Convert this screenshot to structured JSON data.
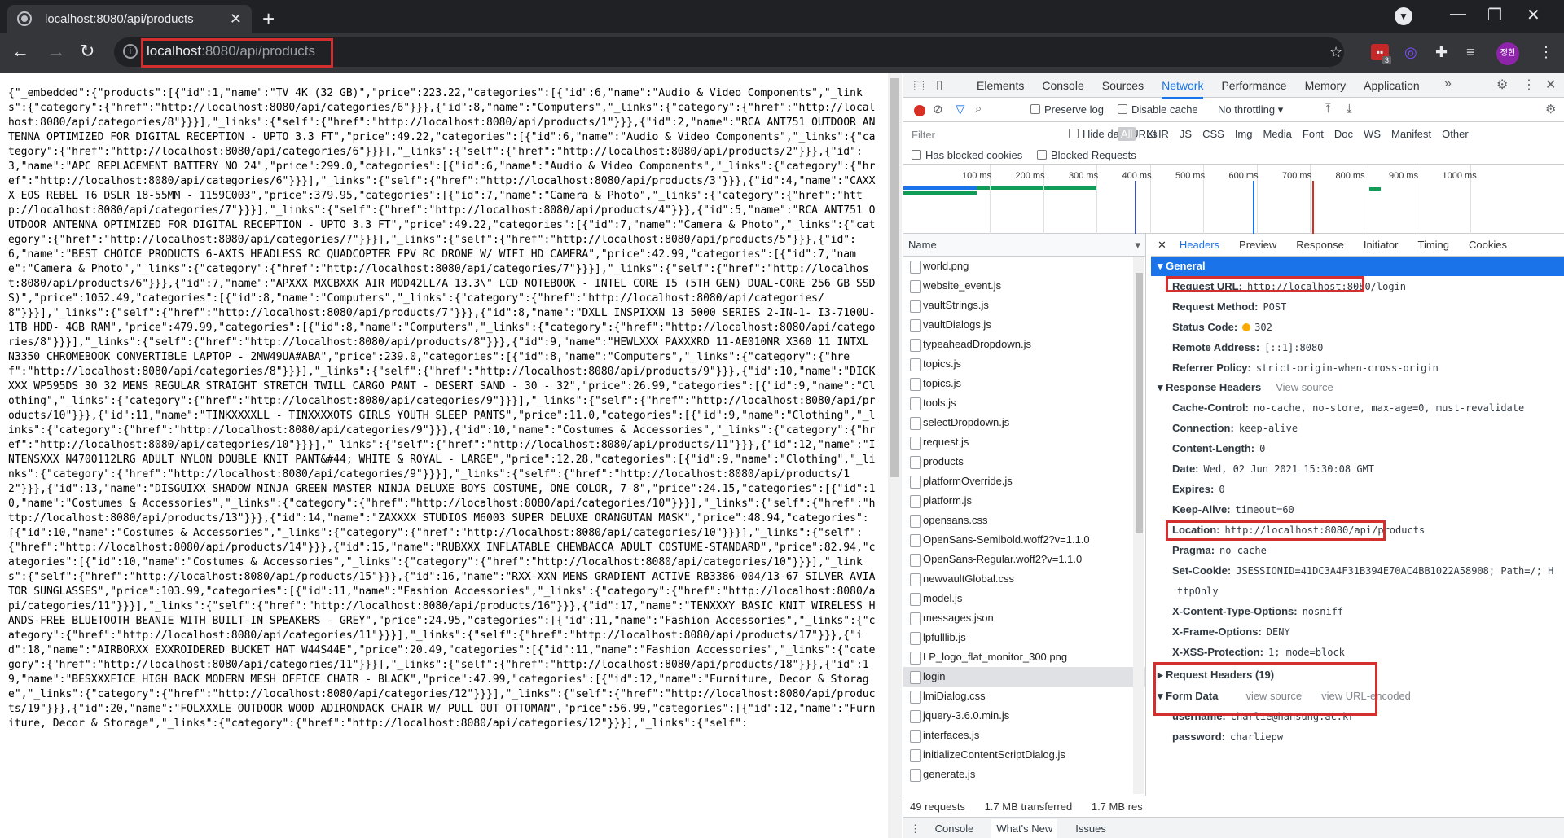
{
  "browser": {
    "tab_title": "localhost:8080/api/products",
    "url_host": "localhost",
    "url_rest": ":8080/api/products",
    "ext_badge": "3",
    "avatar_text": "정현"
  },
  "json_text": "{\"_embedded\":{\"products\":[{\"id\":1,\"name\":\"TV 4K (32 GB)\",\"price\":223.22,\"categories\":[{\"id\":6,\"name\":\"Audio & Video Components\",\"_links\":{\"category\":{\"href\":\"http://localhost:8080/api/categories/6\"}}},{\"id\":8,\"name\":\"Computers\",\"_links\":{\"category\":{\"href\":\"http://localhost:8080/api/categories/8\"}}}],\"_links\":{\"self\":{\"href\":\"http://localhost:8080/api/products/1\"}}},{\"id\":2,\"name\":\"RCA ANT751 OUTDOOR ANTENNA OPTIMIZED FOR DIGITAL RECEPTION - UPTO 3.3 FT\",\"price\":49.22,\"categories\":[{\"id\":6,\"name\":\"Audio & Video Components\",\"_links\":{\"category\":{\"href\":\"http://localhost:8080/api/categories/6\"}}}],\"_links\":{\"self\":{\"href\":\"http://localhost:8080/api/products/2\"}}},{\"id\":3,\"name\":\"APC REPLACEMENT BATTERY NO 24\",\"price\":299.0,\"categories\":[{\"id\":6,\"name\":\"Audio & Video Components\",\"_links\":{\"category\":{\"href\":\"http://localhost:8080/api/categories/6\"}}}],\"_links\":{\"self\":{\"href\":\"http://localhost:8080/api/products/3\"}}},{\"id\":4,\"name\":\"CAXXX EOS REBEL T6 DSLR 18-55MM - 1159C003\",\"price\":379.95,\"categories\":[{\"id\":7,\"name\":\"Camera & Photo\",\"_links\":{\"category\":{\"href\":\"http://localhost:8080/api/categories/7\"}}}],\"_links\":{\"self\":{\"href\":\"http://localhost:8080/api/products/4\"}}},{\"id\":5,\"name\":\"RCA ANT751 OUTDOOR ANTENNA OPTIMIZED FOR DIGITAL RECEPTION - UPTO 3.3 FT\",\"price\":49.22,\"categories\":[{\"id\":7,\"name\":\"Camera & Photo\",\"_links\":{\"category\":{\"href\":\"http://localhost:8080/api/categories/7\"}}}],\"_links\":{\"self\":{\"href\":\"http://localhost:8080/api/products/5\"}}},{\"id\":6,\"name\":\"BEST CHOICE PRODUCTS 6-AXIS HEADLESS RC QUADCOPTER FPV RC DRONE W/ WIFI HD CAMERA\",\"price\":42.99,\"categories\":[{\"id\":7,\"name\":\"Camera & Photo\",\"_links\":{\"category\":{\"href\":\"http://localhost:8080/api/categories/7\"}}}],\"_links\":{\"self\":{\"href\":\"http://localhost:8080/api/products/6\"}}},{\"id\":7,\"name\":\"APXXX MXCBXXK AIR MOD42LL/A 13.3\\\" LCD NOTEBOOK - INTEL CORE I5 (5TH GEN) DUAL-CORE 256 GB SSD S)\",\"price\":1052.49,\"categories\":[{\"id\":8,\"name\":\"Computers\",\"_links\":{\"category\":{\"href\":\"http://localhost:8080/api/categories/8\"}}}],\"_links\":{\"self\":{\"href\":\"http://localhost:8080/api/products/7\"}}},{\"id\":8,\"name\":\"DXLL INSPIXXN 13 5000 SERIES 2-IN-1- I3-7100U- 1TB HDD- 4GB RAM\",\"price\":479.99,\"categories\":[{\"id\":8,\"name\":\"Computers\",\"_links\":{\"category\":{\"href\":\"http://localhost:8080/api/categories/8\"}}}],\"_links\":{\"self\":{\"href\":\"http://localhost:8080/api/products/8\"}}},{\"id\":9,\"name\":\"HEWLXXX PAXXXRD 11-AE010NR X360 11 INTXL N3350 CHROMEBOOK CONVERTIBLE LAPTOP - 2MW49UA#ABA\",\"price\":239.0,\"categories\":[{\"id\":8,\"name\":\"Computers\",\"_links\":{\"category\":{\"href\":\"http://localhost:8080/api/categories/8\"}}}],\"_links\":{\"self\":{\"href\":\"http://localhost:8080/api/products/9\"}}},{\"id\":10,\"name\":\"DICKXXX WP595DS 30 32 MENS REGULAR STRAIGHT STRETCH TWILL CARGO PANT - DESERT SAND - 30 - 32\",\"price\":26.99,\"categories\":[{\"id\":9,\"name\":\"Clothing\",\"_links\":{\"category\":{\"href\":\"http://localhost:8080/api/categories/9\"}}}],\"_links\":{\"self\":{\"href\":\"http://localhost:8080/api/products/10\"}}},{\"id\":11,\"name\":\"TINKXXXXLL - TINXXXXOTS GIRLS YOUTH SLEEP PANTS\",\"price\":11.0,\"categories\":[{\"id\":9,\"name\":\"Clothing\",\"_links\":{\"category\":{\"href\":\"http://localhost:8080/api/categories/9\"}}},{\"id\":10,\"name\":\"Costumes & Accessories\",\"_links\":{\"category\":{\"href\":\"http://localhost:8080/api/categories/10\"}}}],\"_links\":{\"self\":{\"href\":\"http://localhost:8080/api/products/11\"}}},{\"id\":12,\"name\":\"INTENSXXX N4700112LRG ADULT NYLON DOUBLE KNIT PANT&#44; WHITE & ROYAL - LARGE\",\"price\":12.28,\"categories\":[{\"id\":9,\"name\":\"Clothing\",\"_links\":{\"category\":{\"href\":\"http://localhost:8080/api/categories/9\"}}}],\"_links\":{\"self\":{\"href\":\"http://localhost:8080/api/products/12\"}}},{\"id\":13,\"name\":\"DISGUIXX SHADOW NINJA GREEN MASTER NINJA DELUXE BOYS COSTUME, ONE COLOR, 7-8\",\"price\":24.15,\"categories\":[{\"id\":10,\"name\":\"Costumes & Accessories\",\"_links\":{\"category\":{\"href\":\"http://localhost:8080/api/categories/10\"}}}],\"_links\":{\"self\":{\"href\":\"http://localhost:8080/api/products/13\"}}},{\"id\":14,\"name\":\"ZAXXXX STUDIOS M6003 SUPER DELUXE ORANGUTAN MASK\",\"price\":48.94,\"categories\":[{\"id\":10,\"name\":\"Costumes & Accessories\",\"_links\":{\"category\":{\"href\":\"http://localhost:8080/api/categories/10\"}}}],\"_links\":{\"self\":{\"href\":\"http://localhost:8080/api/products/14\"}}},{\"id\":15,\"name\":\"RUBXXX INFLATABLE CHEWBACCA ADULT COSTUME-STANDARD\",\"price\":82.94,\"categories\":[{\"id\":10,\"name\":\"Costumes & Accessories\",\"_links\":{\"category\":{\"href\":\"http://localhost:8080/api/categories/10\"}}}],\"_links\":{\"self\":{\"href\":\"http://localhost:8080/api/products/15\"}}},{\"id\":16,\"name\":\"RXX-XXN MENS GRADIENT ACTIVE RB3386-004/13-67 SILVER AVIATOR SUNGLASSES\",\"price\":103.99,\"categories\":[{\"id\":11,\"name\":\"Fashion Accessories\",\"_links\":{\"category\":{\"href\":\"http://localhost:8080/api/categories/11\"}}}],\"_links\":{\"self\":{\"href\":\"http://localhost:8080/api/products/16\"}}},{\"id\":17,\"name\":\"TENXXXY BASIC KNIT WIRELESS HANDS-FREE BLUETOOTH BEANIE WITH BUILT-IN SPEAKERS - GREY\",\"price\":24.95,\"categories\":[{\"id\":11,\"name\":\"Fashion Accessories\",\"_links\":{\"category\":{\"href\":\"http://localhost:8080/api/categories/11\"}}}],\"_links\":{\"self\":{\"href\":\"http://localhost:8080/api/products/17\"}}},{\"id\":18,\"name\":\"AIRBORXX EXXROIDERED BUCKET HAT W44S44E\",\"price\":20.49,\"categories\":[{\"id\":11,\"name\":\"Fashion Accessories\",\"_links\":{\"category\":{\"href\":\"http://localhost:8080/api/categories/11\"}}}],\"_links\":{\"self\":{\"href\":\"http://localhost:8080/api/products/18\"}}},{\"id\":19,\"name\":\"BESXXXFICE HIGH BACK MODERN MESH OFFICE CHAIR - BLACK\",\"price\":47.99,\"categories\":[{\"id\":12,\"name\":\"Furniture, Decor & Storage\",\"_links\":{\"category\":{\"href\":\"http://localhost:8080/api/categories/12\"}}}],\"_links\":{\"self\":{\"href\":\"http://localhost:8080/api/products/19\"}}},{\"id\":20,\"name\":\"FOLXXXLE OUTDOOR WOOD ADIRONDACK CHAIR W/ PULL OUT OTTOMAN\",\"price\":56.99,\"categories\":[{\"id\":12,\"name\":\"Furniture, Decor & Storage\",\"_links\":{\"category\":{\"href\":\"http://localhost:8080/api/categories/12\"}}}],\"_links\":{\"self\":",
  "devtools": {
    "tabs": [
      "Elements",
      "Console",
      "Sources",
      "Network",
      "Performance",
      "Memory",
      "Application"
    ],
    "preserve_log": "Preserve log",
    "disable_cache": "Disable cache",
    "throttling": "No throttling",
    "filter_placeholder": "Filter",
    "hide_data_urls": "Hide data URLs",
    "type_filters": [
      "All",
      "XHR",
      "JS",
      "CSS",
      "Img",
      "Media",
      "Font",
      "Doc",
      "WS",
      "Manifest",
      "Other"
    ],
    "has_blocked_cookies": "Has blocked cookies",
    "blocked_requests": "Blocked Requests",
    "timeline_ticks": [
      "100 ms",
      "200 ms",
      "300 ms",
      "400 ms",
      "500 ms",
      "600 ms",
      "700 ms",
      "800 ms",
      "900 ms",
      "1000 ms"
    ],
    "name_header": "Name",
    "requests": [
      "world.png",
      "website_event.js",
      "vaultStrings.js",
      "vaultDialogs.js",
      "typeaheadDropdown.js",
      "topics.js",
      "topics.js",
      "tools.js",
      "selectDropdown.js",
      "request.js",
      "products",
      "platformOverride.js",
      "platform.js",
      "opensans.css",
      "OpenSans-Semibold.woff2?v=1.1.0",
      "OpenSans-Regular.woff2?v=1.1.0",
      "newvaultGlobal.css",
      "model.js",
      "messages.json",
      "lpfulllib.js",
      "LP_logo_flat_monitor_300.png",
      "login",
      "lmiDialog.css",
      "jquery-3.6.0.min.js",
      "interfaces.js",
      "initializeContentScriptDialog.js",
      "generate.js"
    ],
    "detail_tabs": [
      "Headers",
      "Preview",
      "Response",
      "Initiator",
      "Timing",
      "Cookies"
    ],
    "general_title": "General",
    "general": [
      {
        "k": "Request URL:",
        "v": "http://localhost:8080/login"
      },
      {
        "k": "Request Method:",
        "v": "POST"
      },
      {
        "k": "Status Code:",
        "v": "302"
      },
      {
        "k": "Remote Address:",
        "v": "[::1]:8080"
      },
      {
        "k": "Referrer Policy:",
        "v": "strict-origin-when-cross-origin"
      }
    ],
    "response_headers_title": "Response Headers",
    "view_source": "view source",
    "view_source_cap": "View source",
    "view_url_encoded": "view URL-encoded",
    "response_headers": [
      {
        "k": "Cache-Control:",
        "v": "no-cache, no-store, max-age=0, must-revalidate"
      },
      {
        "k": "Connection:",
        "v": "keep-alive"
      },
      {
        "k": "Content-Length:",
        "v": "0"
      },
      {
        "k": "Date:",
        "v": "Wed, 02 Jun 2021 15:30:08 GMT"
      },
      {
        "k": "Expires:",
        "v": "0"
      },
      {
        "k": "Keep-Alive:",
        "v": "timeout=60"
      },
      {
        "k": "Location:",
        "v": "http://localhost:8080/api/products"
      },
      {
        "k": "Pragma:",
        "v": "no-cache"
      },
      {
        "k": "Set-Cookie:",
        "v": "JSESSIONID=41DC3A4F31B394E70AC4BB1022A58908; Path=/; H"
      },
      {
        "k": "",
        "v": "ttpOnly"
      },
      {
        "k": "X-Content-Type-Options:",
        "v": "nosniff"
      },
      {
        "k": "X-Frame-Options:",
        "v": "DENY"
      },
      {
        "k": "X-XSS-Protection:",
        "v": "1; mode=block"
      }
    ],
    "request_headers_title": "Request Headers (19)",
    "form_data_title": "Form Data",
    "form_data": [
      {
        "k": "username:",
        "v": "charlie@hansung.ac.kr"
      },
      {
        "k": "password:",
        "v": "charliepw"
      }
    ],
    "status_requests": "49 requests",
    "status_transferred": "1.7 MB transferred",
    "status_resources": "1.7 MB res",
    "drawer_tabs": [
      "Console",
      "What's New",
      "Issues"
    ],
    "accent": "#1a73e8",
    "highlight": "#d32f2f"
  }
}
